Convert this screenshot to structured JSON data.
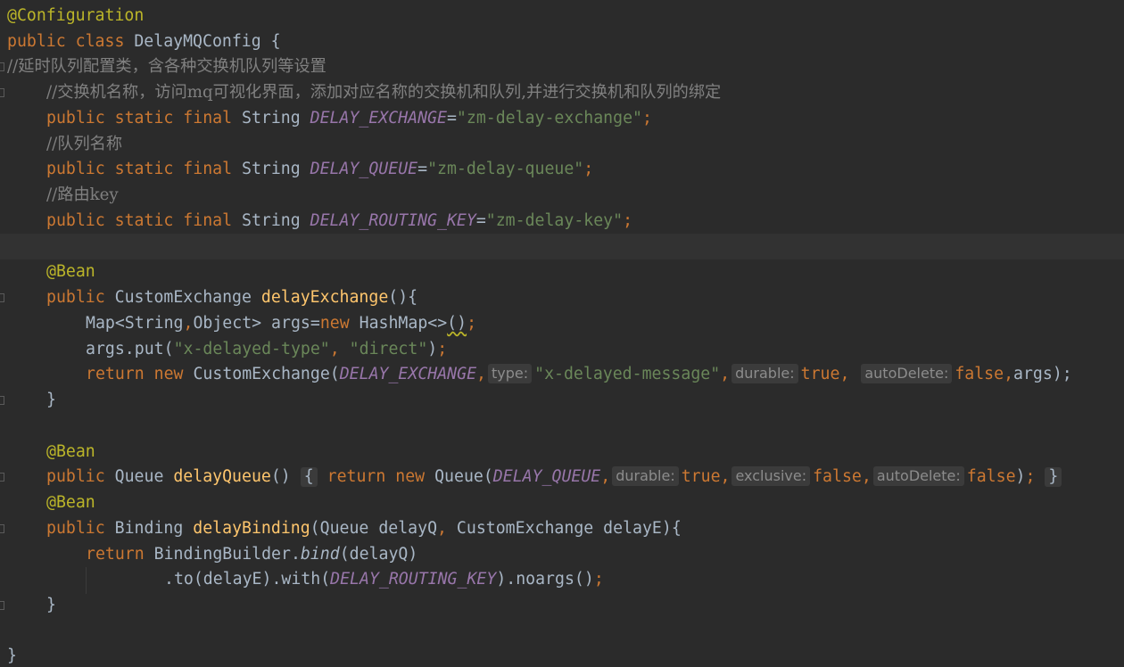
{
  "editor": {
    "lines": {
      "l01": {
        "ann": "@Configuration"
      },
      "l02": {
        "kw1": "public",
        "kw2": "class",
        "name": "DelayMQConfig",
        "brace": " {"
      },
      "l03": {
        "comment": "//延时队列配置类，含各种交换机队列等设置"
      },
      "l04": {
        "comment": "//交换机名称，访问mq可视化界面，添加对应名称的交换机和队列,并进行交换机和队列的绑定"
      },
      "l05": {
        "mod": "public static final",
        "type": "String",
        "const": "DELAY_EXCHANGE",
        "eq": "=",
        "str": "\"zm-delay-exchange\"",
        "semi": ";"
      },
      "l06": {
        "comment": "//队列名称"
      },
      "l07": {
        "mod": "public static final",
        "type": "String",
        "const": "DELAY_QUEUE",
        "eq": "=",
        "str": "\"zm-delay-queue\"",
        "semi": ";"
      },
      "l08": {
        "comment": "//路由key"
      },
      "l09": {
        "mod": "public static final",
        "type": "String",
        "const": "DELAY_ROUTING_KEY",
        "eq": "=",
        "str": "\"zm-delay-key\"",
        "semi": ";"
      },
      "l11": {
        "ann": "@Bean"
      },
      "l12": {
        "kw": "public",
        "type": "CustomExchange",
        "fn": "delayExchange",
        "rest": "(){"
      },
      "l13": {
        "a": "Map<String",
        "comma": ",",
        "b": "Object> args=",
        "kw": "new",
        "c": " HashMap<>",
        "d": "()",
        "semi": ";"
      },
      "l14": {
        "a": "args.put(",
        "s1": "\"x-delayed-type\"",
        "comma": ", ",
        "s2": "\"direct\"",
        "close": ")",
        "semi": ";"
      },
      "l15": {
        "kw1": "return",
        "kw2": "new",
        "type": "CustomExchange(",
        "const": "DELAY_EXCHANGE",
        "comma1": ",",
        "hint1": "type:",
        "s1": "\"x-delayed-message\"",
        "comma2": ",",
        "hint2": "durable:",
        "v1": "true",
        "comma3": ",",
        "hint3": "autoDelete:",
        "v2": "false",
        "comma4": ",",
        "args": "args);"
      },
      "l16": {
        "brace": "}"
      },
      "l18": {
        "ann": "@Bean"
      },
      "l19": {
        "kw": "public",
        "type": "Queue",
        "fn": "delayQueue",
        "parens": "()",
        "fold_open": "{",
        "kw2": "return",
        "kw3": "new",
        "call": "Queue(",
        "const": "DELAY_QUEUE",
        "comma1": ",",
        "hint1": "durable:",
        "v1": "true",
        "comma2": ",",
        "hint2": "exclusive:",
        "v2": "false",
        "comma3": ",",
        "hint3": "autoDelete:",
        "v3": "false",
        "close": ")",
        "semi": ";",
        "fold_close": "}"
      },
      "l20": {
        "ann": "@Bean"
      },
      "l21": {
        "kw": "public",
        "type": "Binding",
        "fn": "delayBinding",
        "p1": "(Queue delayQ",
        "comma": ",",
        "p2": " CustomExchange delayE){"
      },
      "l22": {
        "kw": "return",
        "a": "BindingBuilder.",
        "call": "bind",
        "b": "(delayQ)"
      },
      "l23": {
        "a": ".to(delayE).with(",
        "const": "DELAY_ROUTING_KEY",
        "b": ").noargs()",
        "semi": ";"
      },
      "l24": {
        "brace": "}"
      },
      "l26": {
        "brace": "}"
      }
    }
  },
  "colors": {
    "background": "#2b2b2b",
    "current_line": "#323232",
    "keyword": "#cc7832",
    "annotation": "#bbb529",
    "string": "#6a8759",
    "constant": "#9876aa",
    "method": "#ffc66d",
    "comment": "#808080",
    "text": "#a9b7c6"
  }
}
